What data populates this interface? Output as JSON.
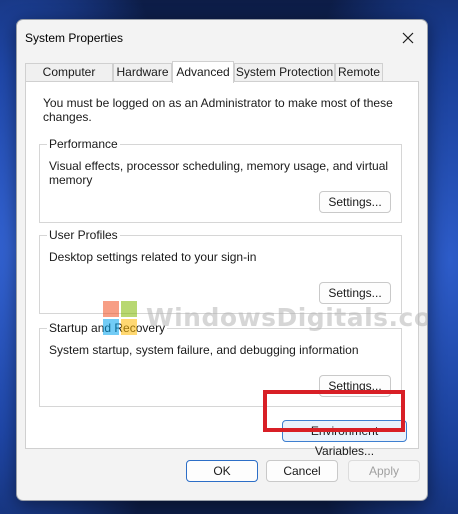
{
  "window": {
    "title": "System Properties"
  },
  "tabs": [
    {
      "label": "Computer Name",
      "active": false
    },
    {
      "label": "Hardware",
      "active": false
    },
    {
      "label": "Advanced",
      "active": true
    },
    {
      "label": "System Protection",
      "active": false
    },
    {
      "label": "Remote",
      "active": false
    }
  ],
  "advanced": {
    "notice": "You must be logged on as an Administrator to make most of these changes.",
    "performance": {
      "title": "Performance",
      "description": "Visual effects, processor scheduling, memory usage, and virtual memory",
      "button": "Settings..."
    },
    "user_profiles": {
      "title": "User Profiles",
      "description": "Desktop settings related to your sign-in",
      "button": "Settings..."
    },
    "startup_recovery": {
      "title": "Startup and Recovery",
      "description": "System startup, system failure, and debugging information",
      "button": "Settings..."
    },
    "env_button": "Environment Variables..."
  },
  "footer": {
    "ok": "OK",
    "cancel": "Cancel",
    "apply": "Apply"
  },
  "watermark": {
    "text": "WindowsDigitals.com"
  },
  "colors": {
    "highlight": "#d81f26",
    "accent": "#2c6ec7"
  },
  "icons": {
    "close": "close-icon",
    "logo": "windows-logo-icon"
  }
}
